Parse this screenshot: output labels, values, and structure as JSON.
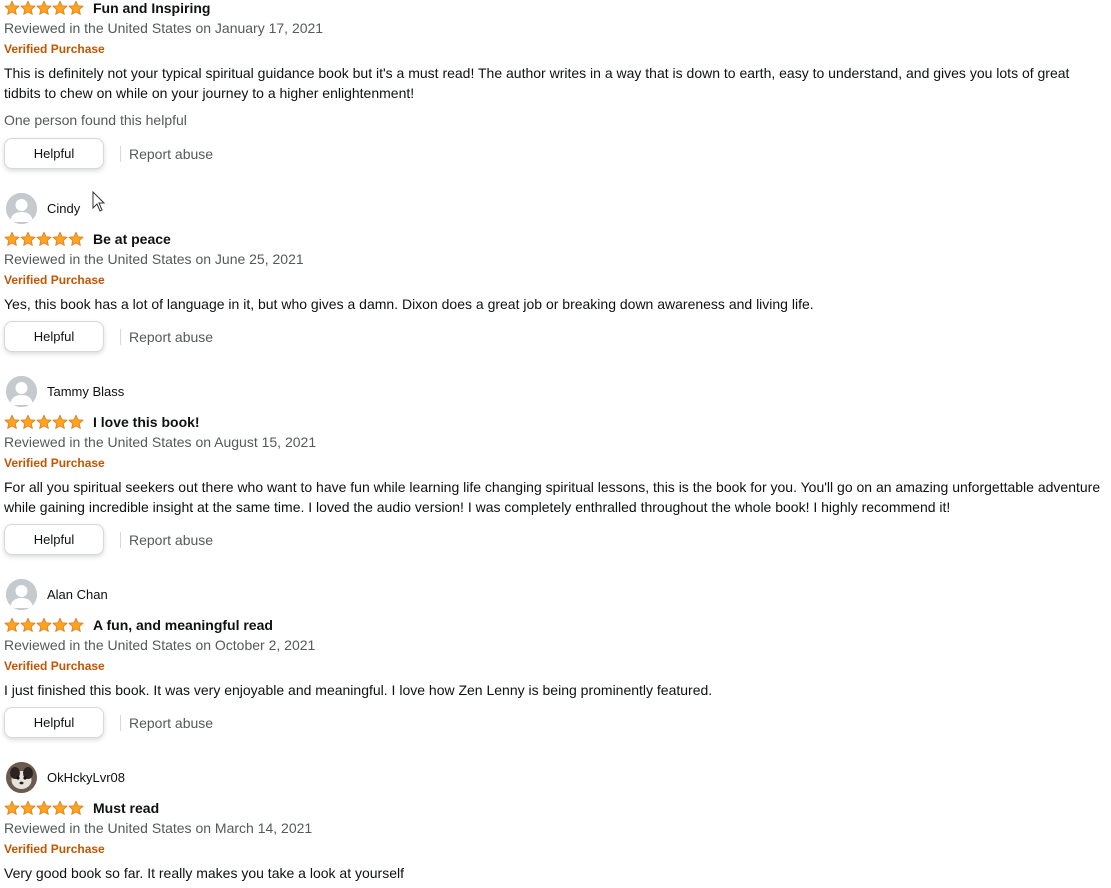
{
  "colors": {
    "star": "#ffa41c",
    "verified": "#c45500",
    "muted": "#565959"
  },
  "reviews": [
    {
      "reviewer": "",
      "rating": 5,
      "title": "Fun and Inspiring",
      "date": "Reviewed in the United States on January 17, 2021",
      "verified": "Verified Purchase",
      "body": "This is definitely not your typical spiritual guidance book but it's a must read! The author writes in a way that is down to earth, easy to understand, and gives you lots of great tidbits to chew on while on your journey to a higher enlightenment!",
      "found_helpful": "One person found this helpful",
      "helpful_label": "Helpful",
      "report_label": "Report abuse"
    },
    {
      "reviewer": "Cindy",
      "rating": 5,
      "title": "Be at peace",
      "date": "Reviewed in the United States on June 25, 2021",
      "verified": "Verified Purchase",
      "body": "Yes, this book has a lot of language in it, but who gives a damn. Dixon does a great job or breaking down awareness and living life.",
      "helpful_label": "Helpful",
      "report_label": "Report abuse"
    },
    {
      "reviewer": "Tammy Blass",
      "rating": 5,
      "title": "I love this book!",
      "date": "Reviewed in the United States on August 15, 2021",
      "verified": "Verified Purchase",
      "body": "For all you spiritual seekers out there who want to have fun while learning life changing spiritual lessons, this is the book for you. You'll go on an amazing unforgettable adventure while gaining incredible insight at the same time. I loved the audio version! I was completely enthralled throughout the whole book! I highly recommend it!",
      "helpful_label": "Helpful",
      "report_label": "Report abuse"
    },
    {
      "reviewer": "Alan Chan",
      "rating": 5,
      "title": "A fun, and meaningful read",
      "date": "Reviewed in the United States on October 2, 2021",
      "verified": "Verified Purchase",
      "body": "I just finished this book. It was very enjoyable and meaningful. I love how Zen Lenny is being prominently featured.",
      "helpful_label": "Helpful",
      "report_label": "Report abuse"
    },
    {
      "reviewer": "OkHckyLvr08",
      "rating": 5,
      "title": "Must read",
      "date": "Reviewed in the United States on March 14, 2021",
      "verified": "Verified Purchase",
      "body": "Very good book so far. It really makes you take a look at yourself"
    }
  ]
}
